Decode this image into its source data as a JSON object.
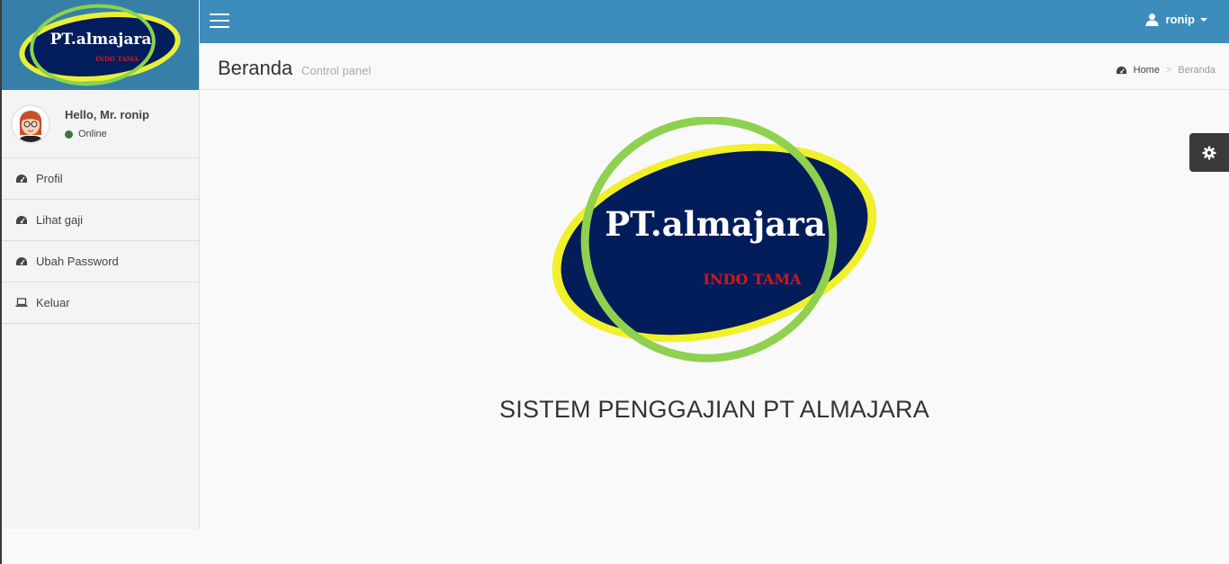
{
  "brand": {
    "logo_text": "PT.almajara",
    "logo_subtext": "INDO TAMA",
    "icon": "company-logo"
  },
  "user_panel": {
    "greeting": "Hello, Mr. ronip",
    "status": "Online",
    "status_color": "#3c763d"
  },
  "sidebar": {
    "items": [
      {
        "label": "Profil",
        "icon": "dashboard-icon"
      },
      {
        "label": "Lihat gaji",
        "icon": "dashboard-icon"
      },
      {
        "label": "Ubah Password",
        "icon": "dashboard-icon"
      },
      {
        "label": "Keluar",
        "icon": "laptop-icon"
      }
    ]
  },
  "topbar": {
    "username": "ronip",
    "color": "#3c8dbc"
  },
  "header": {
    "title": "Beranda",
    "subtitle": "Control panel"
  },
  "breadcrumb": {
    "home": "Home",
    "current": "Beranda"
  },
  "main": {
    "title": "SISTEM PENGGAJIAN PT ALMAJARA"
  }
}
